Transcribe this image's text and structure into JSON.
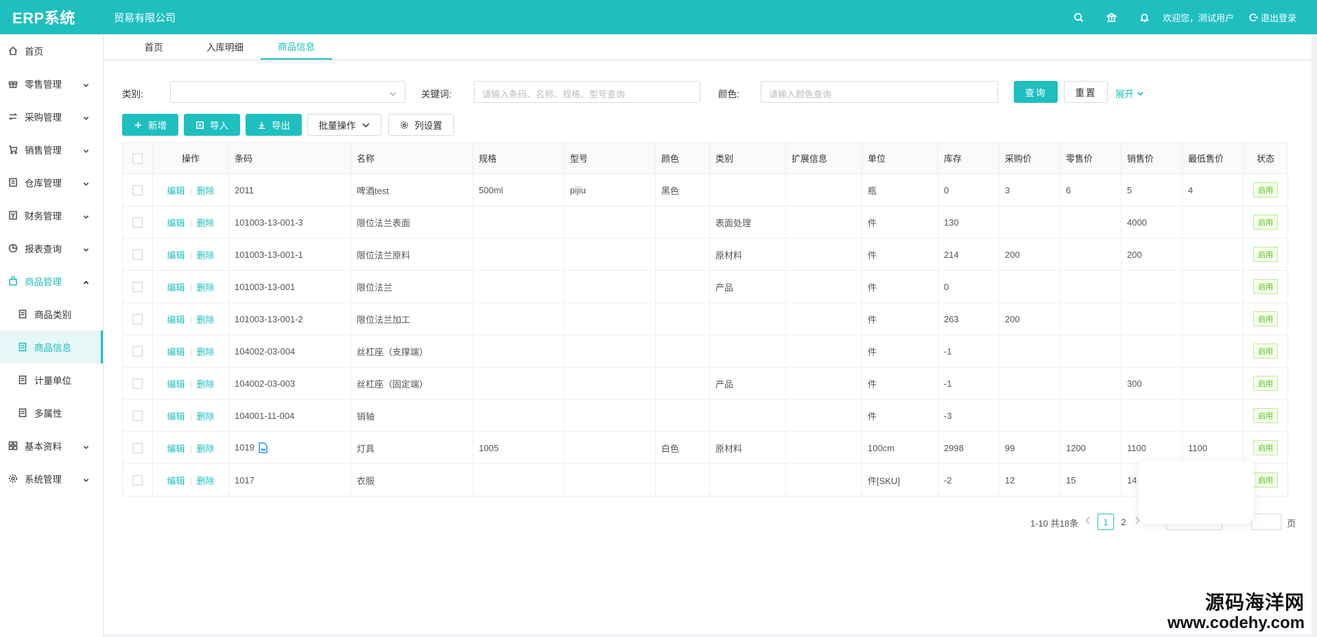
{
  "header": {
    "app_title": "ERP系统",
    "company": "贸易有限公司",
    "welcome": "欢迎您，测试用户",
    "logout": "退出登录",
    "icons": [
      "search-icon",
      "bank-icon",
      "bell-icon"
    ]
  },
  "sidebar": {
    "items": [
      {
        "label": "首页",
        "icon": "home-icon",
        "has_chevron": false
      },
      {
        "label": "零售管理",
        "icon": "gift-icon",
        "has_chevron": true
      },
      {
        "label": "采购管理",
        "icon": "swap-icon",
        "has_chevron": true
      },
      {
        "label": "销售管理",
        "icon": "cart-icon",
        "has_chevron": true
      },
      {
        "label": "仓库管理",
        "icon": "warehouse-icon",
        "has_chevron": true
      },
      {
        "label": "财务管理",
        "icon": "finance-icon",
        "has_chevron": true
      },
      {
        "label": "报表查询",
        "icon": "piechart-icon",
        "has_chevron": true
      },
      {
        "label": "商品管理",
        "icon": "shopping-bag-icon",
        "has_chevron": true,
        "open": true
      },
      {
        "label": "商品类别",
        "icon": "doc-icon",
        "sub": true
      },
      {
        "label": "商品信息",
        "icon": "doc-icon",
        "sub": true,
        "active": true
      },
      {
        "label": "计量单位",
        "icon": "doc-icon",
        "sub": true
      },
      {
        "label": "多属性",
        "icon": "doc-icon",
        "sub": true
      },
      {
        "label": "基本资料",
        "icon": "grid-icon",
        "has_chevron": true
      },
      {
        "label": "系统管理",
        "icon": "gear-icon",
        "has_chevron": true
      }
    ]
  },
  "tabs": [
    {
      "label": "首页",
      "active": false
    },
    {
      "label": "入库明细",
      "active": false
    },
    {
      "label": "商品信息",
      "active": true
    }
  ],
  "filters": {
    "category_label": "类别:",
    "category_value": "",
    "keyword_label": "关键词:",
    "keyword_placeholder": "请输入条码、名称、规格、型号查询",
    "color_label": "颜色:",
    "color_placeholder": "请输入颜色查询",
    "query": "查询",
    "reset": "重置",
    "expand": "展开"
  },
  "toolbar": {
    "add": "新增",
    "import": "导入",
    "export": "导出",
    "batch": "批量操作",
    "columns": "列设置"
  },
  "table": {
    "columns": [
      "操作",
      "条码",
      "名称",
      "规格",
      "型号",
      "颜色",
      "类别",
      "扩展信息",
      "单位",
      "库存",
      "采购价",
      "零售价",
      "销售价",
      "最低售价",
      "状态"
    ],
    "edit_label": "编辑",
    "delete_label": "删除",
    "rows": [
      {
        "barcode": "2011",
        "name": "啤酒test",
        "spec": "500ml",
        "model": "pijiu",
        "color": "黑色",
        "category": "",
        "ext": "",
        "unit": "瓶",
        "stock": "0",
        "purchase": "3",
        "retail": "6",
        "sale": "5",
        "min": "4",
        "status": "启用",
        "file": false
      },
      {
        "barcode": "101003-13-001-3",
        "name": "限位法兰表面",
        "spec": "",
        "model": "",
        "color": "",
        "category": "表面处理",
        "ext": "",
        "unit": "件",
        "stock": "130",
        "purchase": "",
        "retail": "",
        "sale": "4000",
        "min": "",
        "status": "启用",
        "file": false
      },
      {
        "barcode": "101003-13-001-1",
        "name": "限位法兰原料",
        "spec": "",
        "model": "",
        "color": "",
        "category": "原材料",
        "ext": "",
        "unit": "件",
        "stock": "214",
        "purchase": "200",
        "retail": "",
        "sale": "200",
        "min": "",
        "status": "启用",
        "file": false
      },
      {
        "barcode": "101003-13-001",
        "name": "限位法兰",
        "spec": "",
        "model": "",
        "color": "",
        "category": "产品",
        "ext": "",
        "unit": "件",
        "stock": "0",
        "purchase": "",
        "retail": "",
        "sale": "",
        "min": "",
        "status": "启用",
        "file": false
      },
      {
        "barcode": "101003-13-001-2",
        "name": "限位法兰加工",
        "spec": "",
        "model": "",
        "color": "",
        "category": "",
        "ext": "",
        "unit": "件",
        "stock": "263",
        "purchase": "200",
        "retail": "",
        "sale": "",
        "min": "",
        "status": "启用",
        "file": false
      },
      {
        "barcode": "104002-03-004",
        "name": "丝杠座（支撑端）",
        "spec": "",
        "model": "",
        "color": "",
        "category": "",
        "ext": "",
        "unit": "件",
        "stock": "-1",
        "purchase": "",
        "retail": "",
        "sale": "",
        "min": "",
        "status": "启用",
        "file": false
      },
      {
        "barcode": "104002-03-003",
        "name": "丝杠座（固定端）",
        "spec": "",
        "model": "",
        "color": "",
        "category": "产品",
        "ext": "",
        "unit": "件",
        "stock": "-1",
        "purchase": "",
        "retail": "",
        "sale": "300",
        "min": "",
        "status": "启用",
        "file": false
      },
      {
        "barcode": "104001-11-004",
        "name": "销轴",
        "spec": "",
        "model": "",
        "color": "",
        "category": "",
        "ext": "",
        "unit": "件",
        "stock": "-3",
        "purchase": "",
        "retail": "",
        "sale": "",
        "min": "",
        "status": "启用",
        "file": false
      },
      {
        "barcode": "1019",
        "name": "灯具",
        "spec": "1005",
        "model": "",
        "color": "白色",
        "category": "原材料",
        "ext": "",
        "unit": "100cm",
        "stock": "2998",
        "purchase": "99",
        "retail": "1200",
        "sale": "1100",
        "min": "1100",
        "status": "启用",
        "file": true
      },
      {
        "barcode": "1017",
        "name": "衣服",
        "spec": "",
        "model": "",
        "color": "",
        "category": "",
        "ext": "",
        "unit": "件[SKU]",
        "stock": "-2",
        "purchase": "12",
        "retail": "15",
        "sale": "14",
        "min": "",
        "status": "启用",
        "file": false
      }
    ]
  },
  "pagination": {
    "summary": "1-10 共18条",
    "pages": [
      "1",
      "2"
    ],
    "current": "1",
    "page_unit": "页"
  },
  "watermark": {
    "line1": "源码海洋网",
    "line2": "www.codehy.com"
  },
  "colors": {
    "accent": "#1fbfbf",
    "status_green": "#52c41a"
  }
}
